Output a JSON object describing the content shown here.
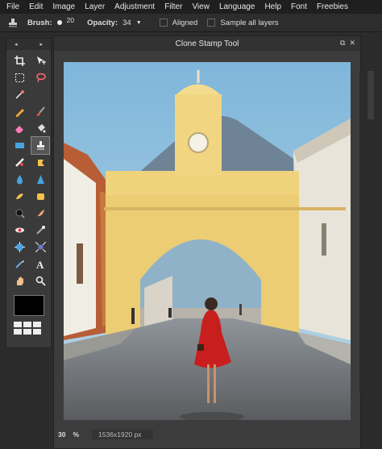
{
  "menu": [
    "File",
    "Edit",
    "Image",
    "Layer",
    "Adjustment",
    "Filter",
    "View",
    "Language",
    "Help",
    "Font",
    "Freebies"
  ],
  "options": {
    "brush_label": "Brush:",
    "brush_size": "20",
    "opacity_label": "Opacity:",
    "opacity_value": "34",
    "aligned_label": "Aligned",
    "sample_all_label": "Sample all layers"
  },
  "toolbox": {
    "arrow_left": "◂",
    "arrow_right": "▸",
    "tools": [
      "crop-icon",
      "move-icon",
      "marquee-icon",
      "lasso-icon",
      "magic-wand-icon",
      "",
      "pencil-icon",
      "brush-icon",
      "eraser-icon",
      "bucket-icon",
      "gradient-icon",
      "clone-stamp-icon",
      "heal-icon",
      "patch-icon",
      "blur-icon",
      "sharpen-icon",
      "smudge-icon",
      "sponge-icon",
      "burn-icon",
      "dodge-icon",
      "redeye-icon",
      "replace-color-icon",
      "bloat-icon",
      "pinch-icon",
      "picker-icon",
      "text-icon",
      "hand-icon",
      "zoom-icon"
    ],
    "selected_tool": "clone-stamp-icon",
    "foreground_color": "#000000"
  },
  "panel": {
    "title": "Clone Stamp Tool",
    "zoom": "30",
    "zoom_unit": "%",
    "dimensions": "1536x1920 px"
  }
}
